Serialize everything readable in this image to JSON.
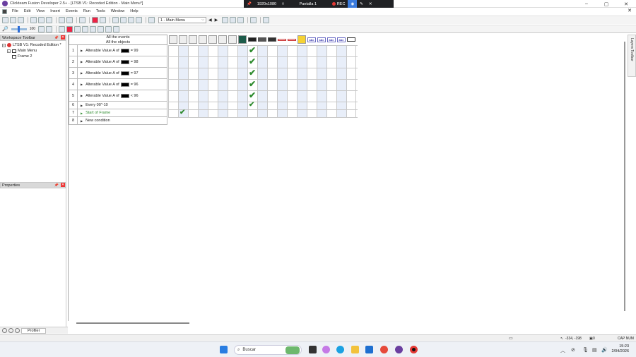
{
  "window": {
    "title": "Clickteam Fusion Developer 2.5+ - [LTSB V1: Recoded Edition - Main Menu*]",
    "controls": [
      "–",
      "▢",
      "✕"
    ]
  },
  "recording_bar": {
    "resolution": "1920x1080",
    "screen": "Pantalla 1",
    "rec_label": "REC"
  },
  "menu": {
    "items": [
      "File",
      "Edit",
      "View",
      "Insert",
      "Events",
      "Run",
      "Tools",
      "Window",
      "Help"
    ]
  },
  "toolbar": {
    "frame_selector": "1 - Main Menu",
    "zoom": "100"
  },
  "workspace": {
    "title": "Workspace Toolbar",
    "tree": {
      "root": "LTSB V1: Recoded Edition *",
      "frames": [
        "Main Menu",
        "Frame 2"
      ]
    }
  },
  "properties": {
    "title": "Properties"
  },
  "profiler": {
    "tab_label": "Profiler"
  },
  "events": {
    "header_line1": "All the events",
    "header_line2": "All the objects",
    "rows": [
      {
        "num": "1",
        "pre": "Alterable Value A of",
        "post": "= 99"
      },
      {
        "num": "2",
        "pre": "Alterable Value A of",
        "post": "= 98"
      },
      {
        "num": "3",
        "pre": "Alterable Value A of",
        "post": "= 97"
      },
      {
        "num": "4",
        "pre": "Alterable Value A of",
        "post": "= 96"
      },
      {
        "num": "5",
        "pre": "Alterable Value A of",
        "post": "< 96"
      },
      {
        "num": "6",
        "pre": "Every 00\"-10",
        "post": ""
      },
      {
        "num": "7",
        "pre": "Start of Frame",
        "post": ""
      },
      {
        "num": "8",
        "pre": "New condition",
        "post": ""
      }
    ]
  },
  "layers": {
    "label": "Layers Toolbar"
  },
  "status": {
    "coords": "-334, -198",
    "count": "0",
    "caps": "CAP NUM"
  },
  "taskbar": {
    "search_placeholder": "Buscar",
    "time": "15:23",
    "date": "2/04/2026"
  },
  "colors": {
    "check": "#2e8b2e",
    "start_of_frame_text": "#2e8b2e",
    "active_column": "#1d5b4a"
  }
}
